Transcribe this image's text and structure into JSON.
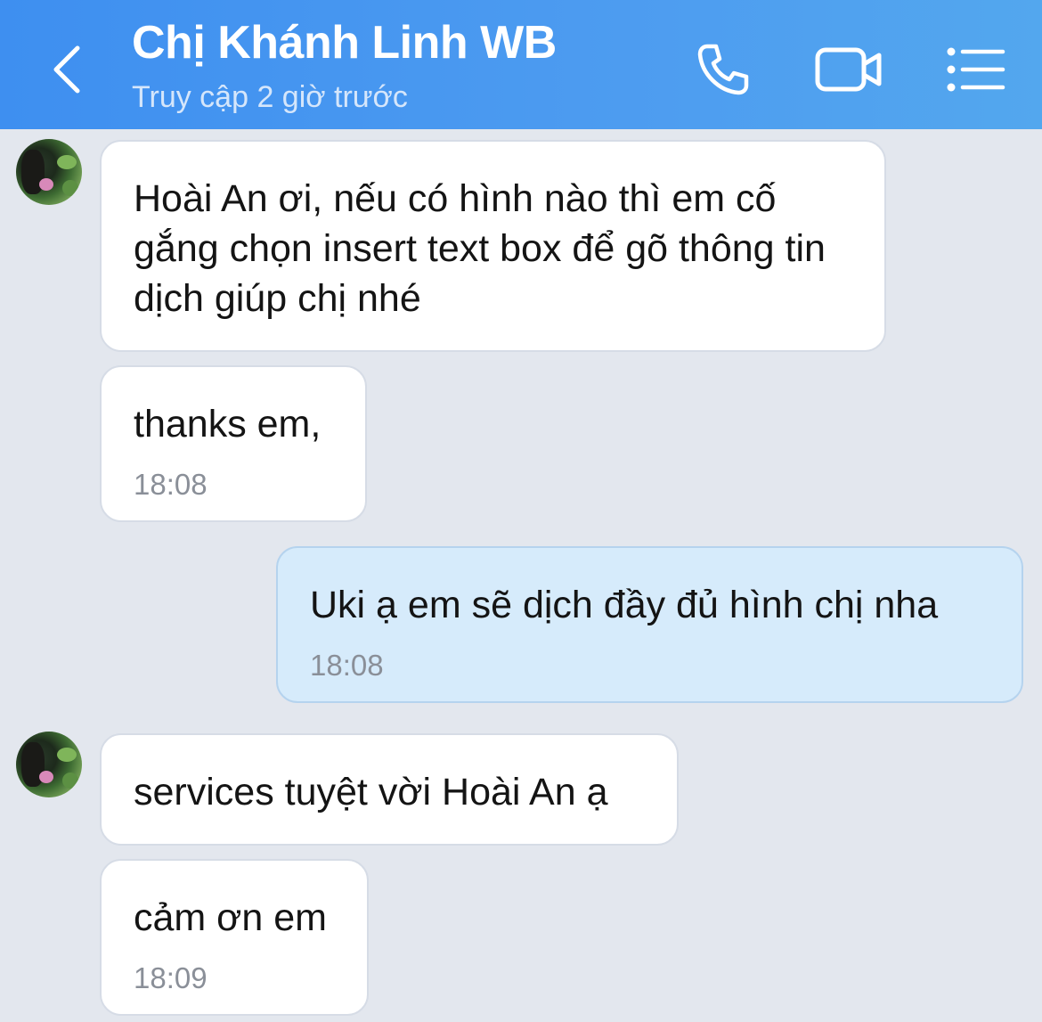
{
  "header": {
    "title": "Chị Khánh Linh WB",
    "subtitle": "Truy cập 2 giờ trước",
    "back_icon": "chevron-left-icon",
    "call_icon": "phone-icon",
    "video_icon": "video-camera-icon",
    "menu_icon": "list-menu-icon"
  },
  "colors": {
    "header_bg": "#4596F0",
    "chat_bg": "#E3E7EE",
    "received_bubble": "#FFFFFF",
    "sent_bubble": "#D6EBFB"
  },
  "messages": [
    {
      "direction": "received",
      "text": "Hoài An ơi, nếu có hình nào thì em cố gắng chọn insert text box để gõ thông tin dịch giúp chị nhé",
      "time": ""
    },
    {
      "direction": "received",
      "text": "thanks em,",
      "time": "18:08"
    },
    {
      "direction": "sent",
      "text": "Uki ạ em sẽ dịch đầy đủ hình chị nha",
      "time": "18:08"
    },
    {
      "direction": "received",
      "text": "services tuyệt vời Hoài An ạ",
      "time": ""
    },
    {
      "direction": "received",
      "text": "cảm ơn em",
      "time": "18:09"
    }
  ]
}
